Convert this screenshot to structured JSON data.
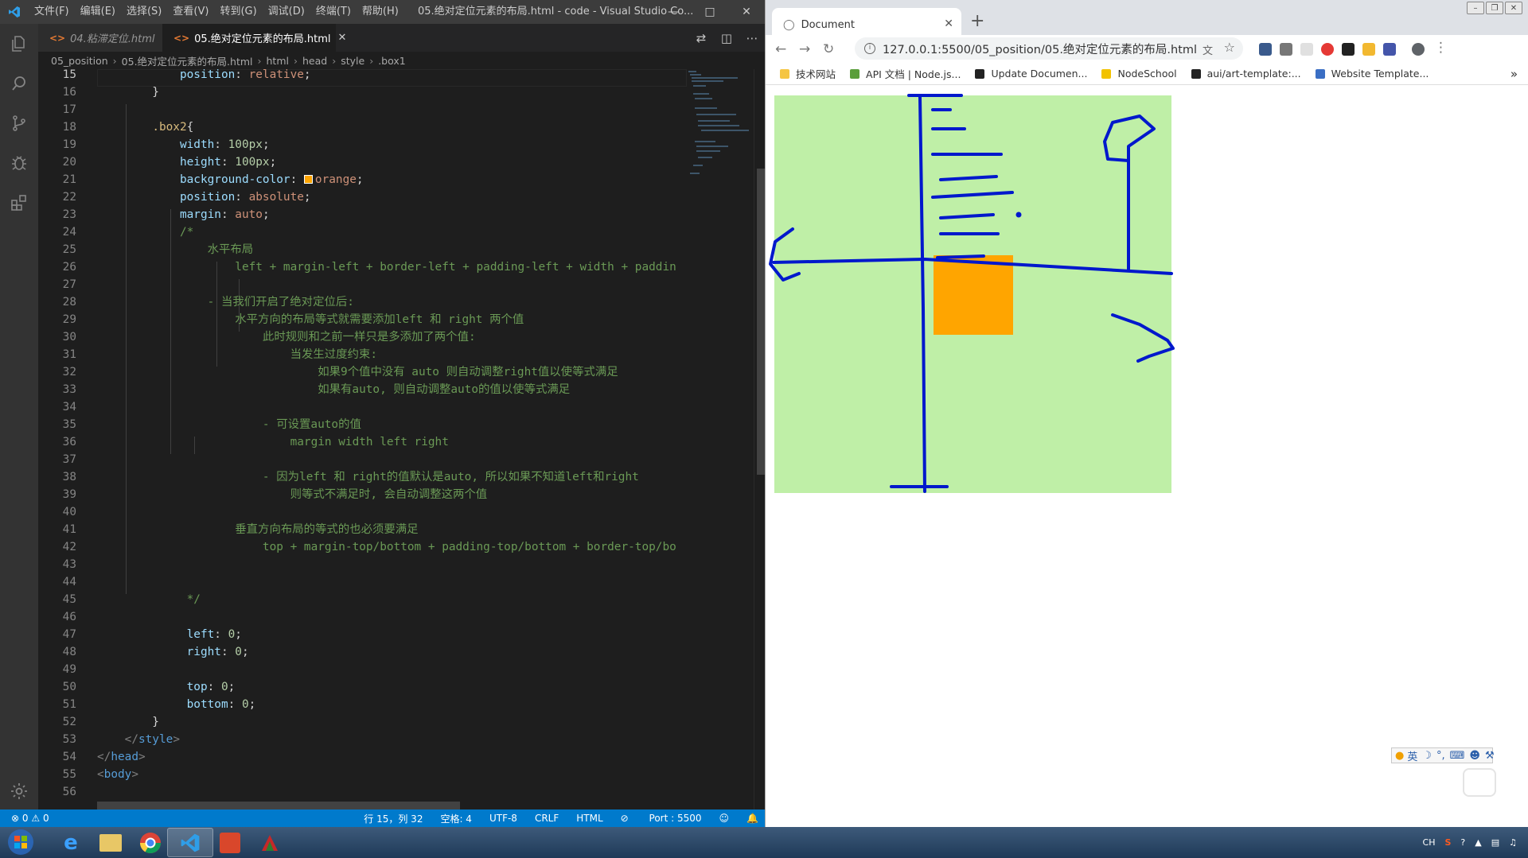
{
  "vscode": {
    "menu": [
      "文件(F)",
      "编辑(E)",
      "选择(S)",
      "查看(V)",
      "转到(G)",
      "调试(D)",
      "终端(T)",
      "帮助(H)"
    ],
    "window_title": "05.绝对定位元素的布局.html - code - Visual Studio Co...",
    "tabs": [
      {
        "label": "04.粘滞定位.html",
        "active": false
      },
      {
        "label": "05.绝对定位元素的布局.html",
        "active": true
      }
    ],
    "breadcrumb": [
      "05_position",
      "05.绝对定位元素的布局.html",
      "html",
      "head",
      "style",
      ".box1"
    ],
    "lines": [
      {
        "n": "15",
        "t": "            position: relative;"
      },
      {
        "n": "16",
        "t": "        }"
      },
      {
        "n": "17",
        "t": ""
      },
      {
        "n": "18",
        "t": "        .box2{"
      },
      {
        "n": "19",
        "t": "            width: 100px;"
      },
      {
        "n": "20",
        "t": "            height: 100px;"
      },
      {
        "n": "21",
        "t": "            background-color: orange;"
      },
      {
        "n": "22",
        "t": "            position: absolute;"
      },
      {
        "n": "23",
        "t": "            margin: auto;"
      },
      {
        "n": "24",
        "t": "            /*"
      },
      {
        "n": "25",
        "t": "                水平布局"
      },
      {
        "n": "26",
        "t": "                    left + margin-left + border-left + padding-left + width + paddin"
      },
      {
        "n": "27",
        "t": ""
      },
      {
        "n": "28",
        "t": "                - 当我们开启了绝对定位后:"
      },
      {
        "n": "29",
        "t": "                    水平方向的布局等式就需要添加left 和 right 两个值"
      },
      {
        "n": "30",
        "t": "                        此时规则和之前一样只是多添加了两个值:"
      },
      {
        "n": "31",
        "t": "                            当发生过度约束:"
      },
      {
        "n": "32",
        "t": "                                如果9个值中没有 auto 则自动调整right值以使等式满足"
      },
      {
        "n": "33",
        "t": "                                如果有auto, 则自动调整auto的值以使等式满足"
      },
      {
        "n": "34",
        "t": ""
      },
      {
        "n": "35",
        "t": "                        - 可设置auto的值"
      },
      {
        "n": "36",
        "t": "                            margin width left right"
      },
      {
        "n": "37",
        "t": ""
      },
      {
        "n": "38",
        "t": "                        - 因为left 和 right的值默认是auto, 所以如果不知道left和right"
      },
      {
        "n": "39",
        "t": "                            则等式不满足时, 会自动调整这两个值"
      },
      {
        "n": "40",
        "t": ""
      },
      {
        "n": "41",
        "t": "                    垂直方向布局的等式的也必须要满足"
      },
      {
        "n": "42",
        "t": "                        top + margin-top/bottom + padding-top/bottom + border-top/bo"
      },
      {
        "n": "43",
        "t": ""
      },
      {
        "n": "44",
        "t": ""
      },
      {
        "n": "45",
        "t": "             */"
      },
      {
        "n": "46",
        "t": ""
      },
      {
        "n": "47",
        "t": "             left: 0;"
      },
      {
        "n": "48",
        "t": "             right: 0;"
      },
      {
        "n": "49",
        "t": ""
      },
      {
        "n": "50",
        "t": "             top: 0;"
      },
      {
        "n": "51",
        "t": "             bottom: 0;"
      },
      {
        "n": "52",
        "t": "        }"
      },
      {
        "n": "53",
        "t": "    </style>"
      },
      {
        "n": "54",
        "t": "</head>"
      },
      {
        "n": "55",
        "t": "<body>"
      },
      {
        "n": "56",
        "t": ""
      }
    ],
    "status": {
      "errors": "0",
      "warnings": "0",
      "position": "行 15，列 32",
      "spaces": "空格: 4",
      "encoding": "UTF-8",
      "eol": "CRLF",
      "language": "HTML",
      "port": "Port : 5500"
    }
  },
  "chrome": {
    "tab_title": "Document",
    "url": "127.0.0.1:5500/05_position/05.绝对定位元素的布局.html",
    "bookmarks": [
      "技术网站",
      "API 文档 | Node.js...",
      "Update Documen...",
      "NodeSchool",
      "aui/art-template:...",
      "Website Template..."
    ],
    "page": {
      "box1_color": "#bfefa7",
      "box2_color": "#ffa500",
      "annotation_color": "#0018cc"
    },
    "ime": {
      "lang": "英"
    }
  },
  "taskbar": {
    "tray_lang": "CH"
  }
}
